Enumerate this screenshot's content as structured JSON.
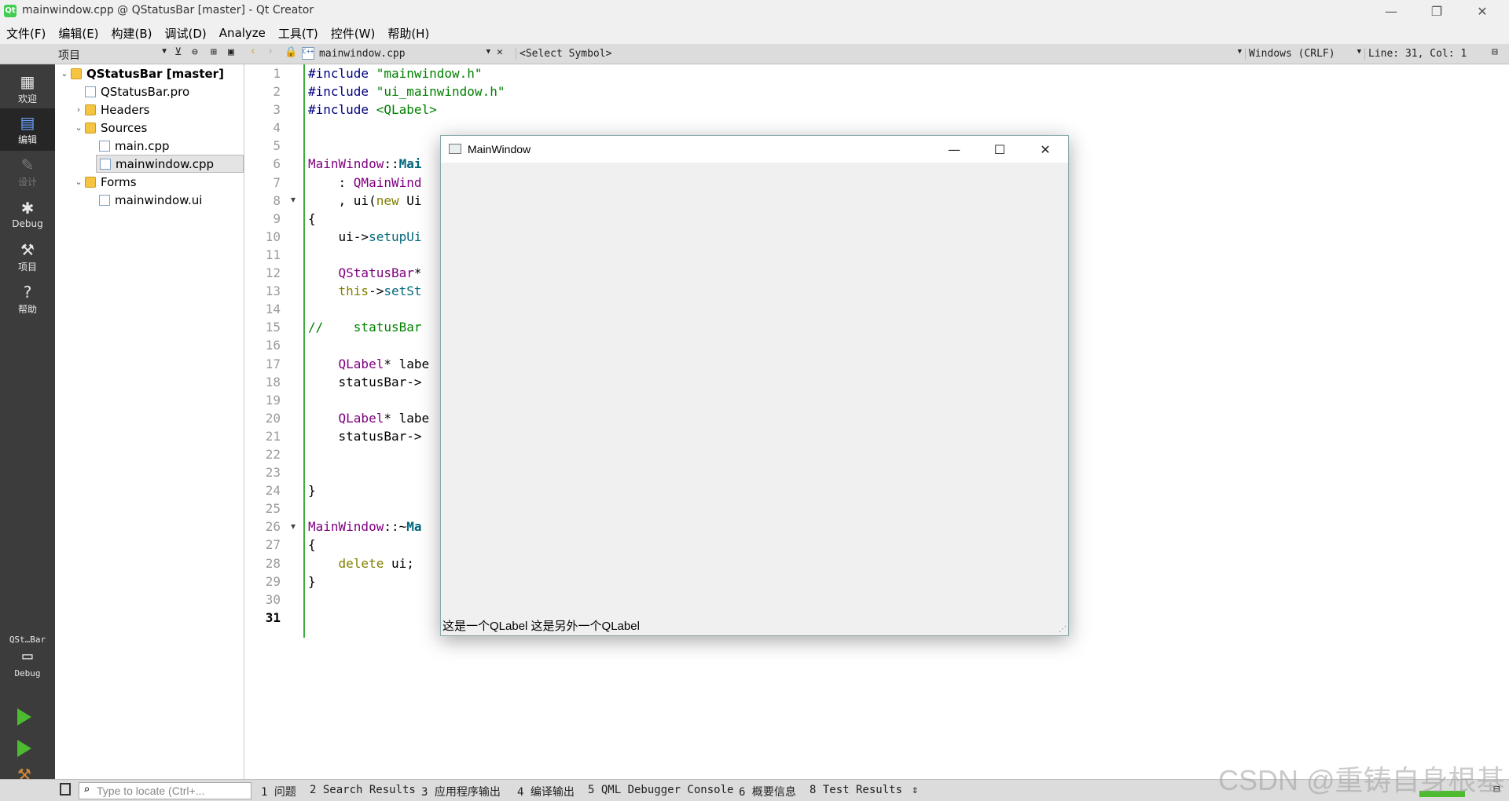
{
  "window": {
    "title": "mainwindow.cpp @ QStatusBar [master] - Qt Creator",
    "minimize": "—",
    "restore": "❐",
    "close": "✕"
  },
  "menu": [
    "文件(F)",
    "编辑(E)",
    "构建(B)",
    "调试(D)",
    "Analyze",
    "工具(T)",
    "控件(W)",
    "帮助(H)"
  ],
  "toolbar": {
    "project_combo": "项目",
    "file_tab": "mainwindow.cpp",
    "symbol": "<Select Symbol>",
    "line_ending": "Windows (CRLF)",
    "cursor": "Line: 31, Col: 1"
  },
  "modes": [
    {
      "label": "欢迎",
      "icon": "grid-icon",
      "state": "normal"
    },
    {
      "label": "编辑",
      "icon": "edit-icon",
      "state": "active"
    },
    {
      "label": "设计",
      "icon": "pencil-icon",
      "state": "disabled"
    },
    {
      "label": "Debug",
      "icon": "bug-icon",
      "state": "normal"
    },
    {
      "label": "项目",
      "icon": "wrench-icon",
      "state": "normal"
    },
    {
      "label": "帮助",
      "icon": "help-icon",
      "state": "normal"
    }
  ],
  "kit": {
    "project": "QSt…Bar",
    "config": "Debug"
  },
  "tree": [
    {
      "label": "QStatusBar [master]",
      "depth": 0,
      "arrow": "open",
      "kind": "project",
      "bold": true
    },
    {
      "label": "QStatusBar.pro",
      "depth": 1,
      "arrow": "none",
      "kind": "file"
    },
    {
      "label": "Headers",
      "depth": 1,
      "arrow": "closed",
      "kind": "folder"
    },
    {
      "label": "Sources",
      "depth": 1,
      "arrow": "open",
      "kind": "folder"
    },
    {
      "label": "main.cpp",
      "depth": 2,
      "arrow": "none",
      "kind": "cpp"
    },
    {
      "label": "mainwindow.cpp",
      "depth": 2,
      "arrow": "none",
      "kind": "cpp",
      "selected": true
    },
    {
      "label": "Forms",
      "depth": 1,
      "arrow": "open",
      "kind": "folder"
    },
    {
      "label": "mainwindow.ui",
      "depth": 2,
      "arrow": "none",
      "kind": "ui"
    }
  ],
  "code_lines": [
    "#include \"mainwindow.h\"",
    "#include \"ui_mainwindow.h\"",
    "#include <QLabel>",
    "",
    "",
    "MainWindow::Mai",
    "    : QMainWind",
    "    , ui(new Ui",
    "{",
    "    ui->setupUi",
    "",
    "    QStatusBar*",
    "    this->setSt",
    "",
    "//    statusBar",
    "",
    "    QLabel* labe",
    "    statusBar->",
    "",
    "    QLabel* labe",
    "    statusBar->",
    "",
    "",
    "}",
    "",
    "MainWindow::~Ma",
    "{",
    "    delete ui;",
    "}",
    "",
    ""
  ],
  "fold_markers": [
    8,
    26
  ],
  "current_line": 31,
  "bottom": {
    "locate_placeholder": "Type to locate (Ctrl+...",
    "tabs": [
      "1 问题",
      "2 Search Results",
      "3 应用程序输出",
      "4 编译输出",
      "5 QML Debugger Console",
      "6 概要信息",
      "8 Test Results"
    ]
  },
  "app_window": {
    "title": "MainWindow",
    "status_text": "这是一个QLabel 这是另外一个QLabel"
  },
  "watermark": "CSDN @重铸自身根基",
  "colors": {
    "accent_green": "#3cae3c",
    "modebar": "#3c3c3c"
  }
}
